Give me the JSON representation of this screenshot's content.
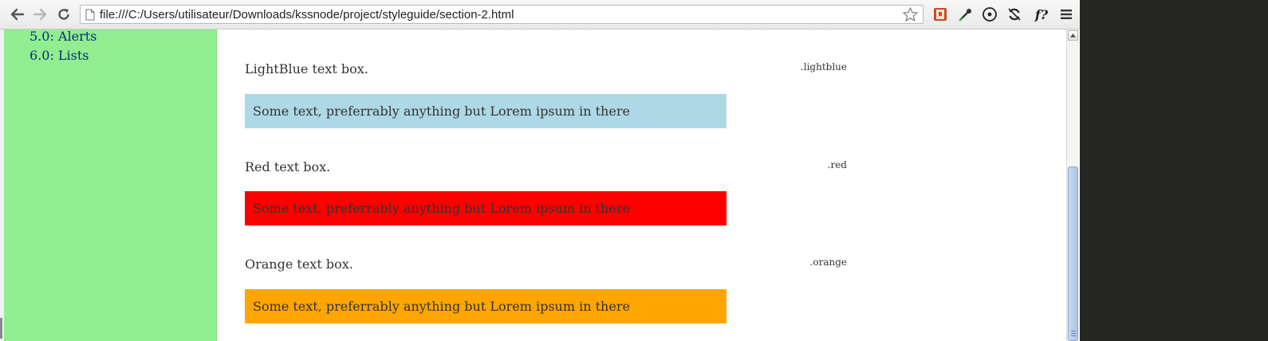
{
  "browser": {
    "url": "file:///C:/Users/utilisateur/Downloads/kssnode/project/styleguide/section-2.html",
    "icons": [
      "back-icon",
      "forward-icon",
      "reload-icon",
      "page-icon",
      "star-icon",
      "extension-icon",
      "eyedropper-icon",
      "target-icon",
      "sync-icon",
      "font-icon",
      "menu-icon"
    ],
    "font_ext_label": "f?"
  },
  "sidebar": {
    "items": [
      {
        "label": "5.0: Alerts"
      },
      {
        "label": "6.0: Lists"
      }
    ]
  },
  "sections": [
    {
      "title": "LightBlue text box.",
      "class_name": ".lightblue",
      "box_text": "Some text, preferrably anything but Lorem ipsum in there",
      "color": "#add8e6"
    },
    {
      "title": "Red text box.",
      "class_name": ".red",
      "box_text": "Some text, preferrably anything but Lorem ipsum in there",
      "color": "#ff0000"
    },
    {
      "title": "Orange text box.",
      "class_name": ".orange",
      "box_text": "Some text, preferrably anything but Lorem ipsum in there",
      "color": "#ffa500"
    }
  ],
  "colors": {
    "sidebar_bg": "#90ee90",
    "desktop_bg": "#262723"
  }
}
